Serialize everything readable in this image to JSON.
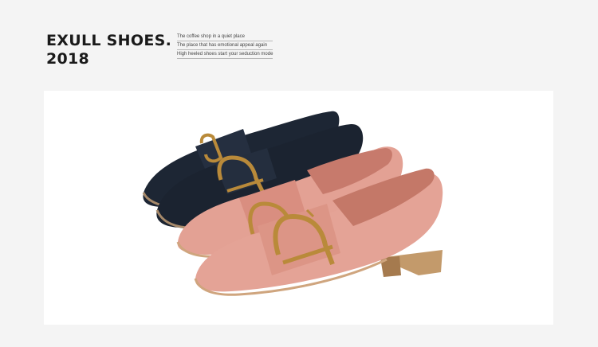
{
  "header": {
    "title_line1": "EXULL SHOES.",
    "title_line2": "2018"
  },
  "taglines": [
    "The coffee shop in a quiet place",
    "The place that has emotional appeal again",
    "High heeled shoes start your seduction mode"
  ],
  "photo": {
    "subject": "shoe-product-photo",
    "colors": {
      "background": "#ffffff",
      "black_suede": "#1d2634",
      "pink_suede": "#e3a194",
      "buckle_gold": "#b98a3a",
      "heel_wood": "#c39a6b"
    }
  }
}
